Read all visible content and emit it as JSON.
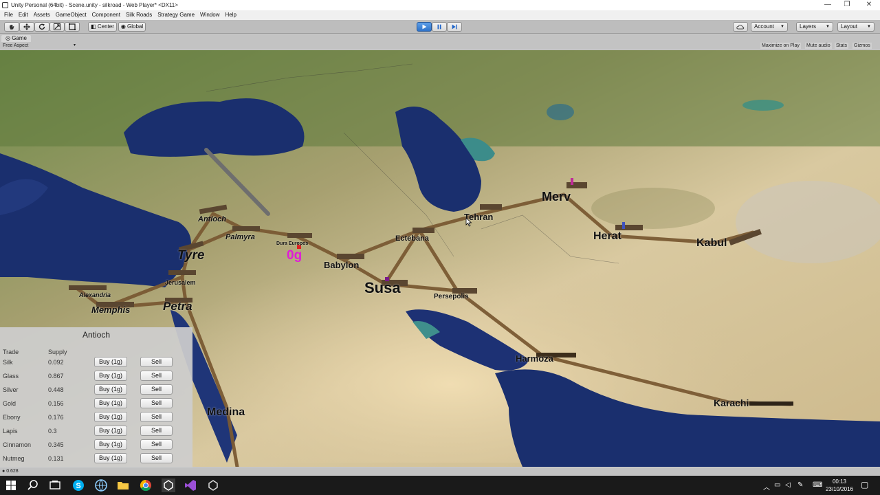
{
  "window": {
    "title": "Unity Personal (64bit) - Scene.unity - silkroad - Web Player* <DX11>",
    "controls": [
      "—",
      "❐",
      "✕"
    ]
  },
  "menubar": [
    "File",
    "Edit",
    "Assets",
    "GameObject",
    "Component",
    "Silk Roads",
    "Strategy Game",
    "Window",
    "Help"
  ],
  "toolbar": {
    "center_label": "Center",
    "global_label": "Global",
    "account_label": "Account",
    "layers_label": "Layers",
    "layout_label": "Layout"
  },
  "game_panel": {
    "tab_label": "Game",
    "aspect": "Free Aspect",
    "options": [
      "Maximize on Play",
      "Mute audio",
      "Stats",
      "Gizmos"
    ]
  },
  "map": {
    "gold_display": "0g",
    "cities": [
      {
        "name": "Antioch"
      },
      {
        "name": "Palmyra"
      },
      {
        "name": "Dura Europos"
      },
      {
        "name": "Tyre"
      },
      {
        "name": "Jerusalem"
      },
      {
        "name": "Alexandria"
      },
      {
        "name": "Memphis"
      },
      {
        "name": "Petra"
      },
      {
        "name": "Babylon"
      },
      {
        "name": "Susa"
      },
      {
        "name": "Ectebana"
      },
      {
        "name": "Tehran"
      },
      {
        "name": "Merv"
      },
      {
        "name": "Herat"
      },
      {
        "name": "Kabul"
      },
      {
        "name": "Persepolis"
      },
      {
        "name": "Harmoza"
      },
      {
        "name": "Karachi"
      },
      {
        "name": "Medina"
      }
    ]
  },
  "trade_panel": {
    "title": "Antioch",
    "col_trade": "Trade",
    "col_supply": "Supply",
    "buy_label": "Buy (1g)",
    "sell_label": "Sell",
    "goods": [
      {
        "name": "Silk",
        "supply": "0.092"
      },
      {
        "name": "Glass",
        "supply": "0.867"
      },
      {
        "name": "Silver",
        "supply": "0.448"
      },
      {
        "name": "Gold",
        "supply": "0.156"
      },
      {
        "name": "Ebony",
        "supply": "0.176"
      },
      {
        "name": "Lapis",
        "supply": "0.3"
      },
      {
        "name": "Cinnamon",
        "supply": "0.345"
      },
      {
        "name": "Nutmeg",
        "supply": "0.131"
      }
    ]
  },
  "statusbar": {
    "text": "0.628"
  },
  "taskbar": {
    "time": "00:13",
    "date": "23/10/2016"
  },
  "colors": {
    "road": "#7a5a33",
    "gold_text": "#e01bd8",
    "sea": "#1a2f6e"
  }
}
